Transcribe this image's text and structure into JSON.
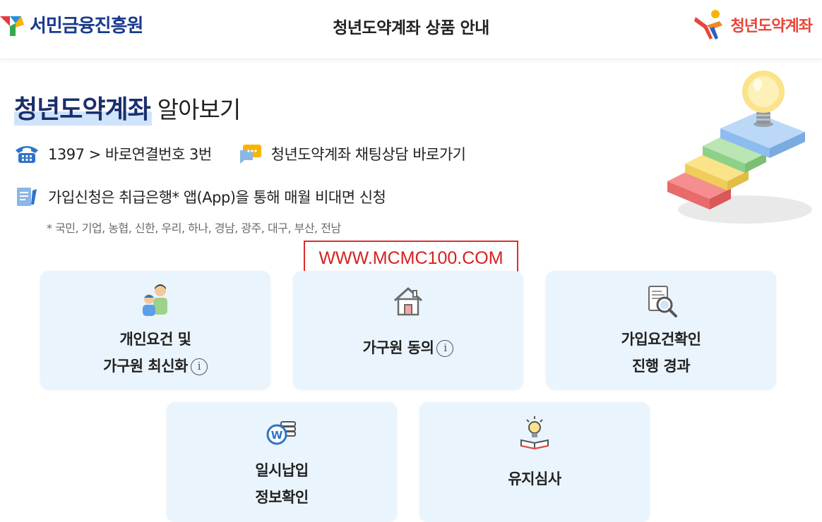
{
  "header": {
    "left_logo_text": "서민금융진흥원",
    "title": "청년도약계좌 상품 안내",
    "right_logo_text": "청년도약계좌"
  },
  "hero": {
    "title_highlight": "청년도약계좌",
    "title_rest": "알아보기"
  },
  "contact": {
    "phone_text": "1397 > 바로연결번호 3번",
    "chat_text": "청년도약계좌 채팅상담 바로가기"
  },
  "apply": {
    "text": "가입신청은 취급은행* 앱(App)을 통해 매월 비대면 신청",
    "note": "* 국민, 기업, 농협, 신한, 우리, 하나, 경남, 광주, 대구, 부산, 전남"
  },
  "watermark": "WWW.MCMC100.COM",
  "cards": [
    {
      "line1": "개인요건 및",
      "line2": "가구원 최신화",
      "info": "i",
      "icon": "family-icon"
    },
    {
      "line1": "가구원 동의",
      "info": "i",
      "icon": "house-icon"
    },
    {
      "line1": "가입요건확인",
      "line2": "진행 경과",
      "icon": "document-search-icon"
    },
    {
      "line1": "일시납입",
      "line2": "정보확인",
      "icon": "won-coins-icon"
    },
    {
      "line1": "유지심사",
      "icon": "lightbulb-book-icon"
    }
  ],
  "colors": {
    "brand_navy": "#1b3a8f",
    "brand_red": "#e8463a",
    "card_bg": "#eaf4fd",
    "highlight": "#cfe4fb",
    "watermark_red": "#d62020"
  }
}
